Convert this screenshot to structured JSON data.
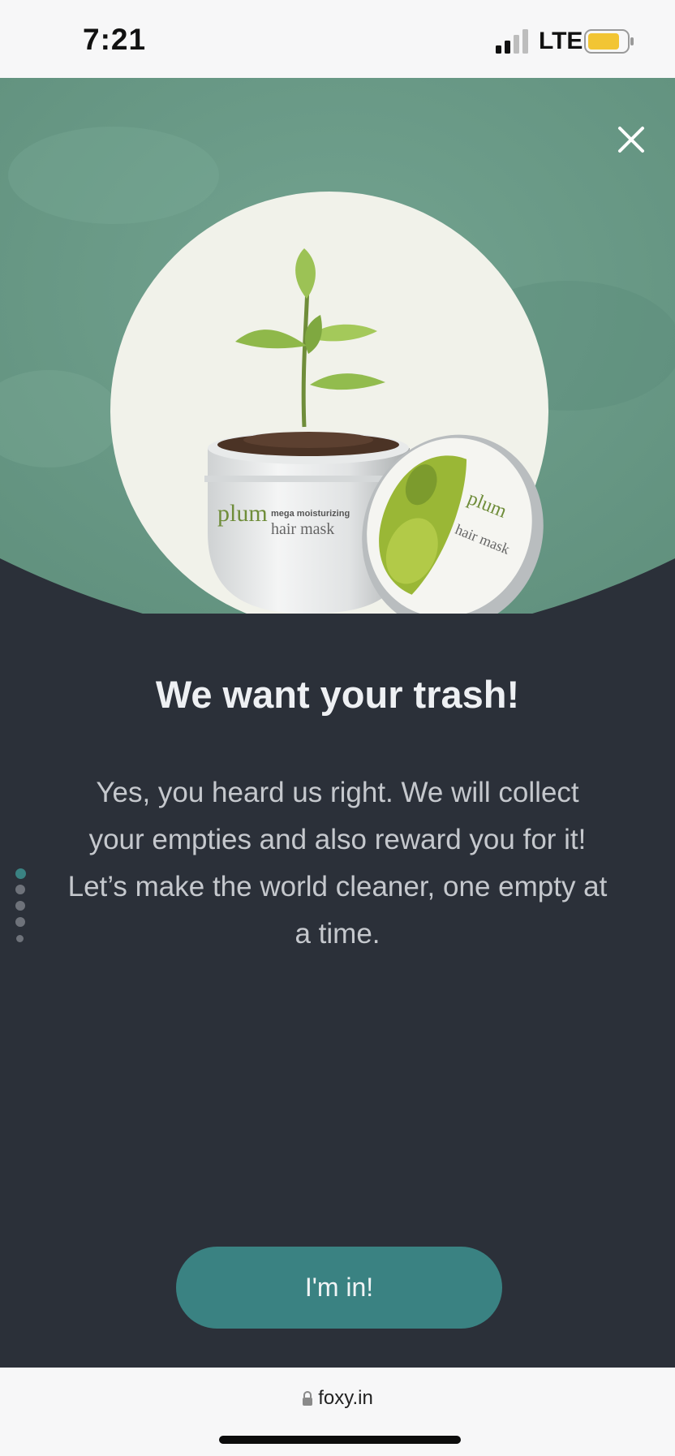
{
  "status_bar": {
    "time": "7:21",
    "network": "LTE",
    "signal_icon": "cellular-signal-icon",
    "battery_icon": "battery-icon",
    "battery_color": "#f2c534"
  },
  "hero": {
    "close_icon": "close-icon",
    "background_color": "#6c9c88",
    "product": {
      "brand": "plum",
      "subtitle": "mega moisturizing",
      "name": "hair mask"
    }
  },
  "content": {
    "headline": "We want your trash!",
    "body": "Yes, you heard us right. We will collect your empties and also reward you for it! Let’s make the world cleaner, one empty at a time."
  },
  "pagination": {
    "count": 5,
    "active_index": 0,
    "active_color": "#3a8282"
  },
  "cta": {
    "label": "I'm in!",
    "color": "#3a8282"
  },
  "browser": {
    "url": "foxy.in",
    "lock_icon": "lock-icon"
  },
  "colors": {
    "panel": "#2b3039",
    "bars": "#f7f7f8"
  }
}
